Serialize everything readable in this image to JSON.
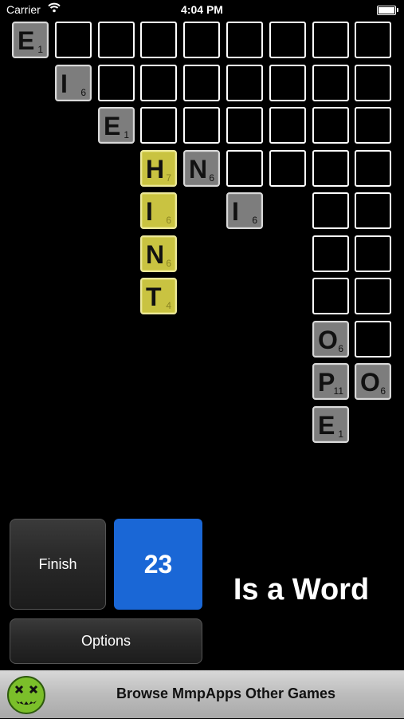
{
  "status_bar": {
    "carrier": "Carrier",
    "time": "4:04 PM",
    "wifi_icon": "wifi-icon",
    "battery_icon": "battery-icon",
    "battery_level": 1.0
  },
  "board": {
    "grid_size": [
      9,
      10
    ],
    "empty_cells": [
      [
        0,
        1
      ],
      [
        0,
        2
      ],
      [
        0,
        3
      ],
      [
        0,
        4
      ],
      [
        0,
        5
      ],
      [
        0,
        6
      ],
      [
        0,
        7
      ],
      [
        0,
        8
      ],
      [
        1,
        2
      ],
      [
        1,
        3
      ],
      [
        1,
        4
      ],
      [
        1,
        5
      ],
      [
        1,
        6
      ],
      [
        1,
        7
      ],
      [
        1,
        8
      ],
      [
        2,
        3
      ],
      [
        2,
        4
      ],
      [
        2,
        5
      ],
      [
        2,
        6
      ],
      [
        2,
        7
      ],
      [
        2,
        8
      ],
      [
        3,
        5
      ],
      [
        3,
        6
      ],
      [
        3,
        7
      ],
      [
        3,
        8
      ],
      [
        4,
        7
      ],
      [
        4,
        8
      ],
      [
        5,
        7
      ],
      [
        5,
        8
      ],
      [
        6,
        7
      ],
      [
        6,
        8
      ],
      [
        7,
        8
      ]
    ],
    "tiles": [
      {
        "row": 0,
        "col": 0,
        "letter": "E",
        "score": "1",
        "hint": false
      },
      {
        "row": 1,
        "col": 1,
        "letter": "I",
        "score": "6",
        "hint": false
      },
      {
        "row": 2,
        "col": 2,
        "letter": "E",
        "score": "1",
        "hint": false
      },
      {
        "row": 3,
        "col": 3,
        "letter": "H",
        "score": "7",
        "hint": true
      },
      {
        "row": 3,
        "col": 4,
        "letter": "N",
        "score": "6",
        "hint": false
      },
      {
        "row": 4,
        "col": 3,
        "letter": "I",
        "score": "6",
        "hint": true
      },
      {
        "row": 4,
        "col": 5,
        "letter": "I",
        "score": "6",
        "hint": false
      },
      {
        "row": 5,
        "col": 3,
        "letter": "N",
        "score": "6",
        "hint": true
      },
      {
        "row": 6,
        "col": 3,
        "letter": "T",
        "score": "4",
        "hint": true
      },
      {
        "row": 7,
        "col": 7,
        "letter": "O",
        "score": "6",
        "hint": false
      },
      {
        "row": 8,
        "col": 7,
        "letter": "P",
        "score": "11",
        "hint": false
      },
      {
        "row": 8,
        "col": 8,
        "letter": "O",
        "score": "6",
        "hint": false
      },
      {
        "row": 9,
        "col": 7,
        "letter": "E",
        "score": "1",
        "hint": false
      }
    ]
  },
  "controls": {
    "finish_label": "Finish",
    "score": "23",
    "word_status": "Is a Word",
    "options_label": "Options"
  },
  "banner": {
    "text": "Browse MmpApps Other Games",
    "logo_icon": "mmpapps-logo-icon"
  },
  "colors": {
    "score_box": "#1a67d6",
    "hint_tile": "#c9c341",
    "tile": "#7d7d7d"
  }
}
